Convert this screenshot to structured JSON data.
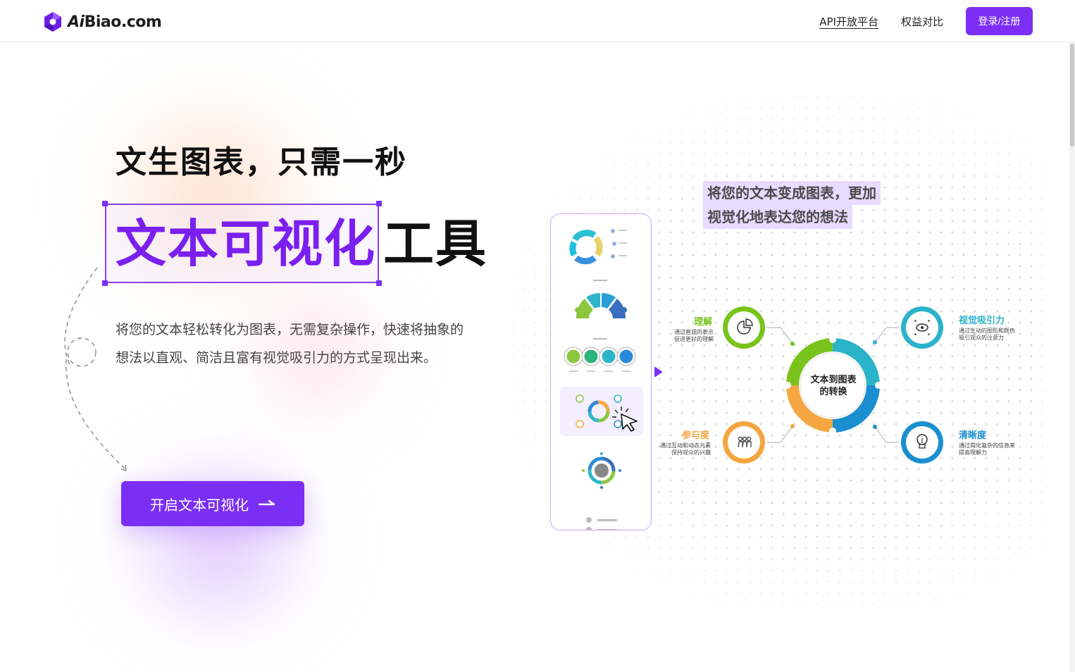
{
  "header": {
    "logo_text_ai": "Ai",
    "logo_text_rest": "Biao.com",
    "nav": [
      {
        "label": "API开放平台"
      },
      {
        "label": "权益对比"
      }
    ],
    "login_label": "登录/注册"
  },
  "hero": {
    "title": "文生图表，只需一秒",
    "highlight": "文本可视化",
    "suffix": "工具",
    "desc_line1": "将您的文本轻松转化为图表，无需复杂操作，快速将抽象的",
    "desc_line2": "想法以直观、简洁且富有视觉吸引力的方式呈现出来。",
    "cta_label": "开启文本可视化"
  },
  "illustration": {
    "quote_line1": "将您的文本变成图表，更加",
    "quote_line2": "视觉化地表达您的想法",
    "center_line1": "文本到图表",
    "center_line2": "的转换",
    "items": [
      {
        "title": "理解",
        "line1": "通过直观的表示",
        "line2": "促进更好的理解",
        "color": "#7ac31c"
      },
      {
        "title": "视觉吸引力",
        "line1": "通过生动的图形和颜色",
        "line2": "吸引观众的注意力",
        "color": "#2bb3c9"
      },
      {
        "title": "参与度",
        "line1": "通过互动和动态元素",
        "line2": "保持观众的兴趣",
        "color": "#f5a640"
      },
      {
        "title": "清晰度",
        "line1": "通过简化复杂的信息来",
        "line2": "提高理解力",
        "color": "#1a8fcf"
      }
    ]
  },
  "colors": {
    "brand": "#7b2ff5",
    "highlight_text": "#7b1ff0"
  }
}
